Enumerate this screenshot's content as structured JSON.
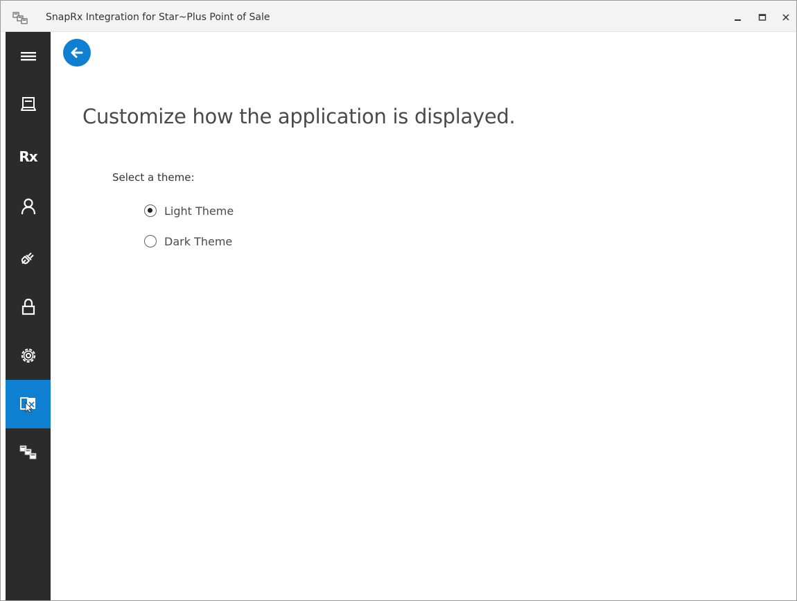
{
  "window": {
    "title": "SnapRx Integration for Star~Plus Point of Sale"
  },
  "sidebar": {
    "items": [
      {
        "name": "menu-icon",
        "label": ""
      },
      {
        "name": "register-icon",
        "label": ""
      },
      {
        "name": "rx-icon",
        "label": "Rx"
      },
      {
        "name": "person-icon",
        "label": ""
      },
      {
        "name": "plug-icon",
        "label": ""
      },
      {
        "name": "lock-icon",
        "label": ""
      },
      {
        "name": "gear-icon",
        "label": ""
      },
      {
        "name": "display-icon",
        "label": "",
        "active": true
      },
      {
        "name": "integration-icon",
        "label": ""
      }
    ],
    "background": "#2b2b2b",
    "active_color": "#0f7fd1"
  },
  "page": {
    "heading": "Customize how the application is displayed.",
    "theme_label": "Select a theme:",
    "themes": [
      {
        "label": "Light Theme",
        "selected": true
      },
      {
        "label": "Dark Theme",
        "selected": false
      }
    ]
  },
  "colors": {
    "accent": "#0f7fd1"
  }
}
